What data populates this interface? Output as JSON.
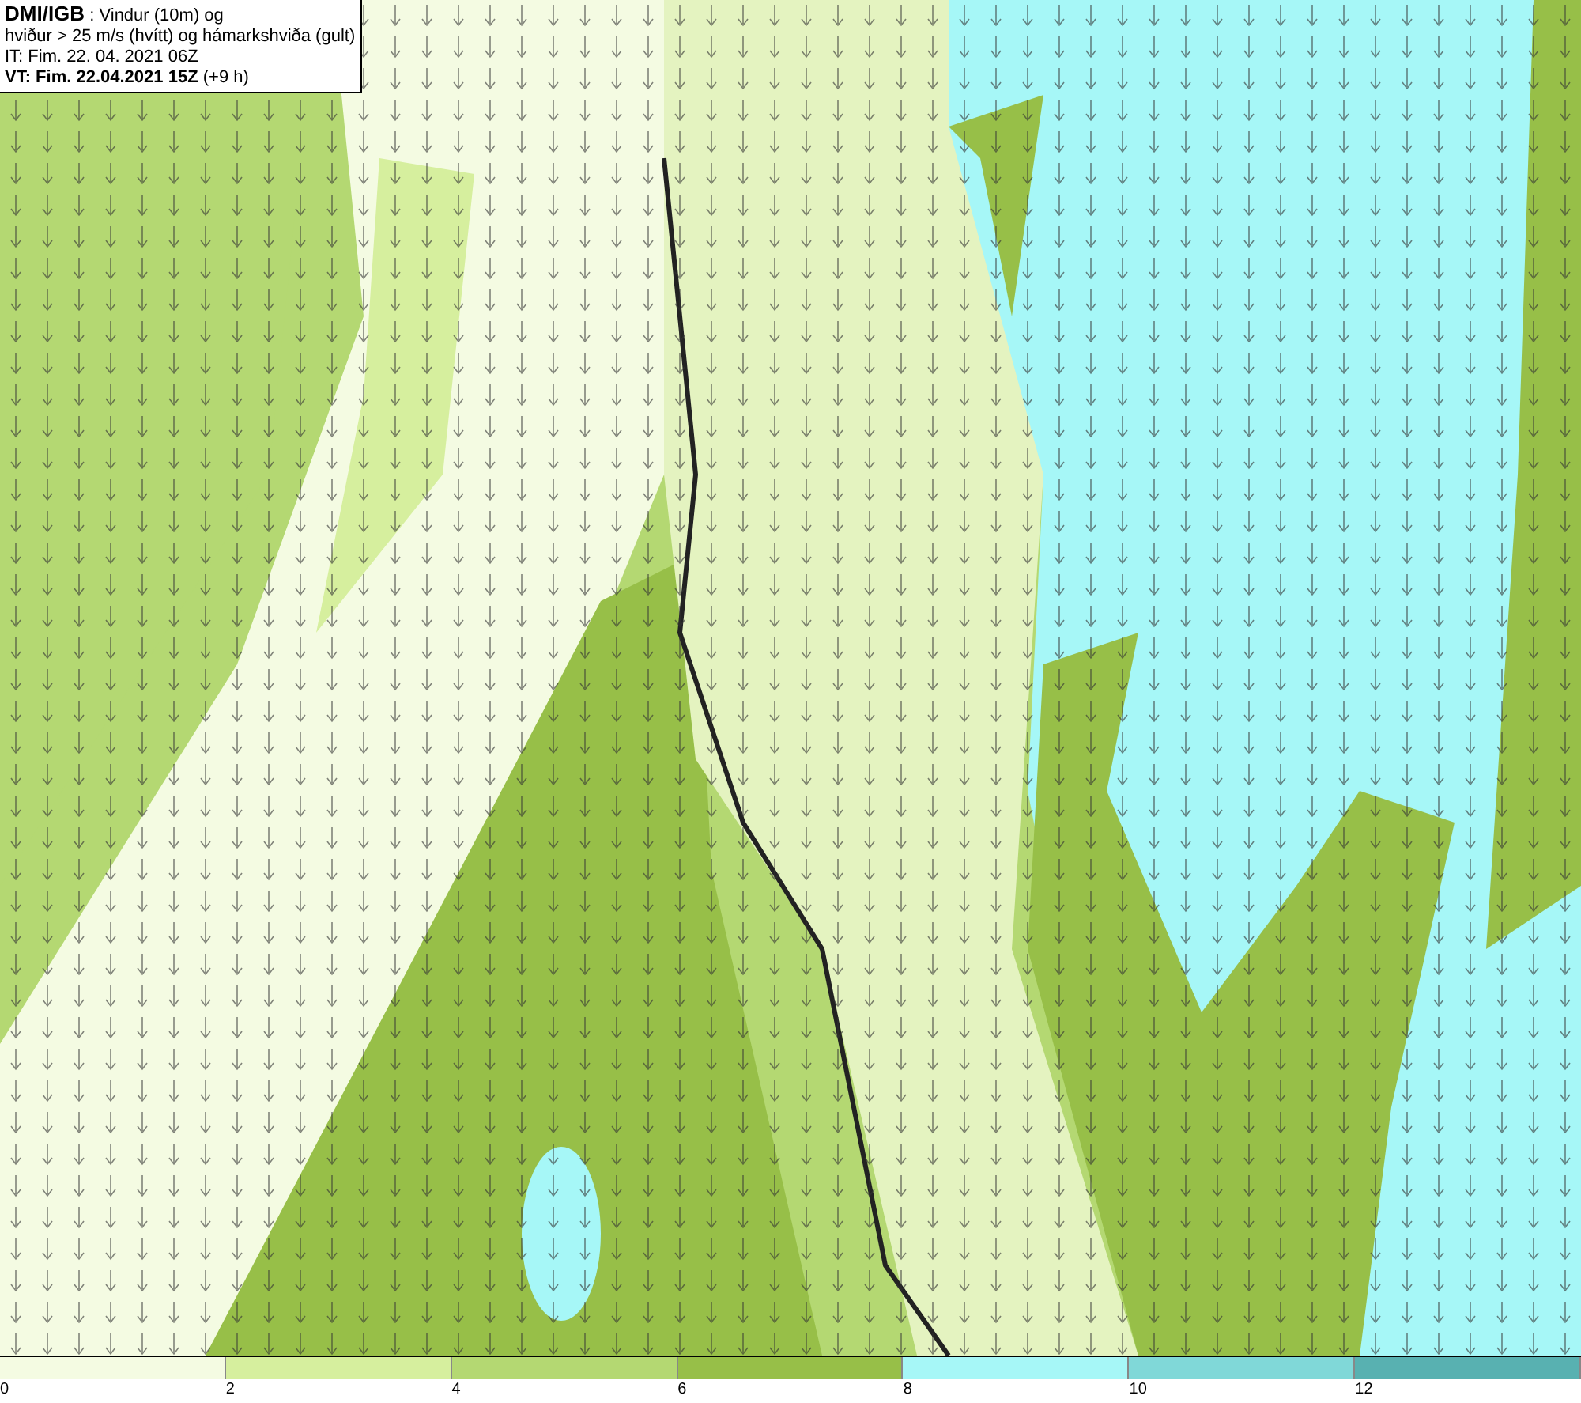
{
  "header": {
    "lines": [
      "**DMI/IGB** : Vindur (10m) og",
      "hviður > 25 m/s (hvítt) og hámarkshviða (gult)",
      "IT: Fim. 22. 04. 2021 06Z",
      "**VT: Fim. 22.04.2021 15Z** (+9 h)"
    ]
  },
  "legend": {
    "bins": [
      {
        "color": "#f4fbe2",
        "tick": "0"
      },
      {
        "color": "#d6ef9e",
        "tick": "2"
      },
      {
        "color": "#b4d872",
        "tick": "4"
      },
      {
        "color": "#97bf48",
        "tick": "6"
      },
      {
        "color": "#a6f7f7",
        "tick": "8"
      },
      {
        "color": "#80d8d8",
        "tick": "10"
      },
      {
        "color": "#58b1b1",
        "tick": "12"
      }
    ]
  }
}
